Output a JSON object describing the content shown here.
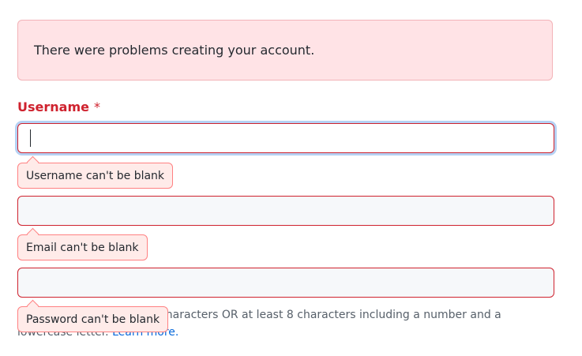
{
  "flash": {
    "message": "There were problems creating your account."
  },
  "username": {
    "label": "Username",
    "required_marker": "*",
    "value": "",
    "error": "Username can't be blank"
  },
  "email": {
    "value": "",
    "error": "Email can't be blank"
  },
  "password": {
    "value": "",
    "error": "Password can't be blank"
  },
  "password_note": {
    "text": "Make sure it's at least 15 characters OR at least 8 characters including a number and a lowercase letter.",
    "link": "Learn more."
  },
  "colors": {
    "error_red": "#cf222e",
    "flash_bg": "#ffe3e6",
    "tip_bg": "#ffebe9",
    "focus_ring": "#0969da"
  }
}
